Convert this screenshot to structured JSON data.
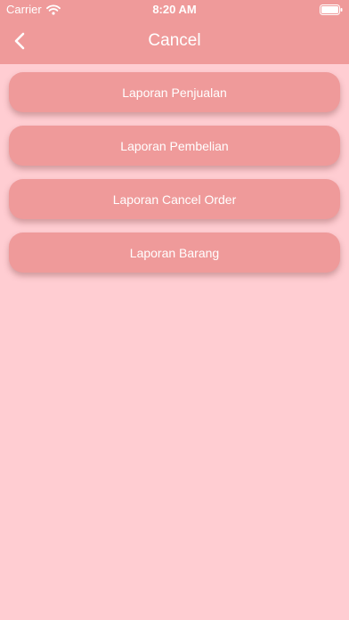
{
  "status_bar": {
    "carrier": "Carrier",
    "time": "8:20 AM"
  },
  "header": {
    "title": "Cancel",
    "back_icon": "chevron-left-icon"
  },
  "menu": {
    "items": [
      {
        "label": "Laporan Penjualan"
      },
      {
        "label": "Laporan Pembelian"
      },
      {
        "label": "Laporan Cancel Order"
      },
      {
        "label": "Laporan Barang"
      }
    ]
  },
  "colors": {
    "appbar": "#ef9a9a",
    "background": "#ffcdd2",
    "button": "#ef9a9a",
    "text": "#ffffff"
  }
}
